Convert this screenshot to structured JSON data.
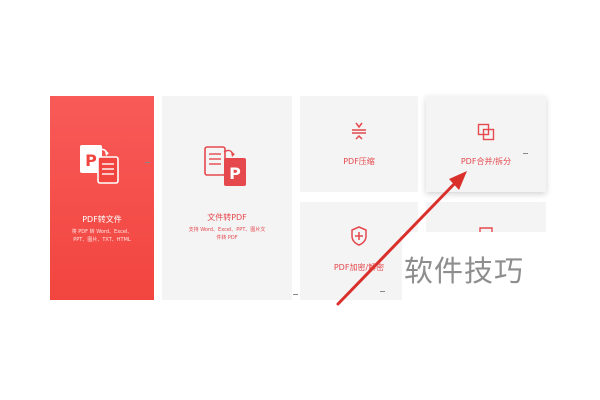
{
  "cards": {
    "pdf_to_file": {
      "title": "PDF转文件",
      "desc_line1": "将 PDF 转 Word、Excel、",
      "desc_line2": "PPT、图片、TXT、HTML"
    },
    "file_to_pdf": {
      "title": "文件转PDF",
      "desc_line1": "支持 Word、Excel、PPT、图片文",
      "desc_line2": "件转 PDF"
    },
    "compress": {
      "title": "PDF压缩"
    },
    "merge_split": {
      "title": "PDF合并/拆分"
    },
    "encrypt": {
      "title": "PDF加密/解密"
    }
  },
  "watermark": "软件技巧",
  "colors": {
    "accent": "#e5484d",
    "red_card": "#f2453f",
    "card_bg": "#f4f4f4",
    "arrow": "#d9302c"
  },
  "icons": {
    "pdf_to_file": "pdf-to-document-icon",
    "file_to_pdf": "document-to-pdf-icon",
    "compress": "compress-icon",
    "merge_split": "merge-split-icon",
    "encrypt": "shield-plus-icon"
  }
}
